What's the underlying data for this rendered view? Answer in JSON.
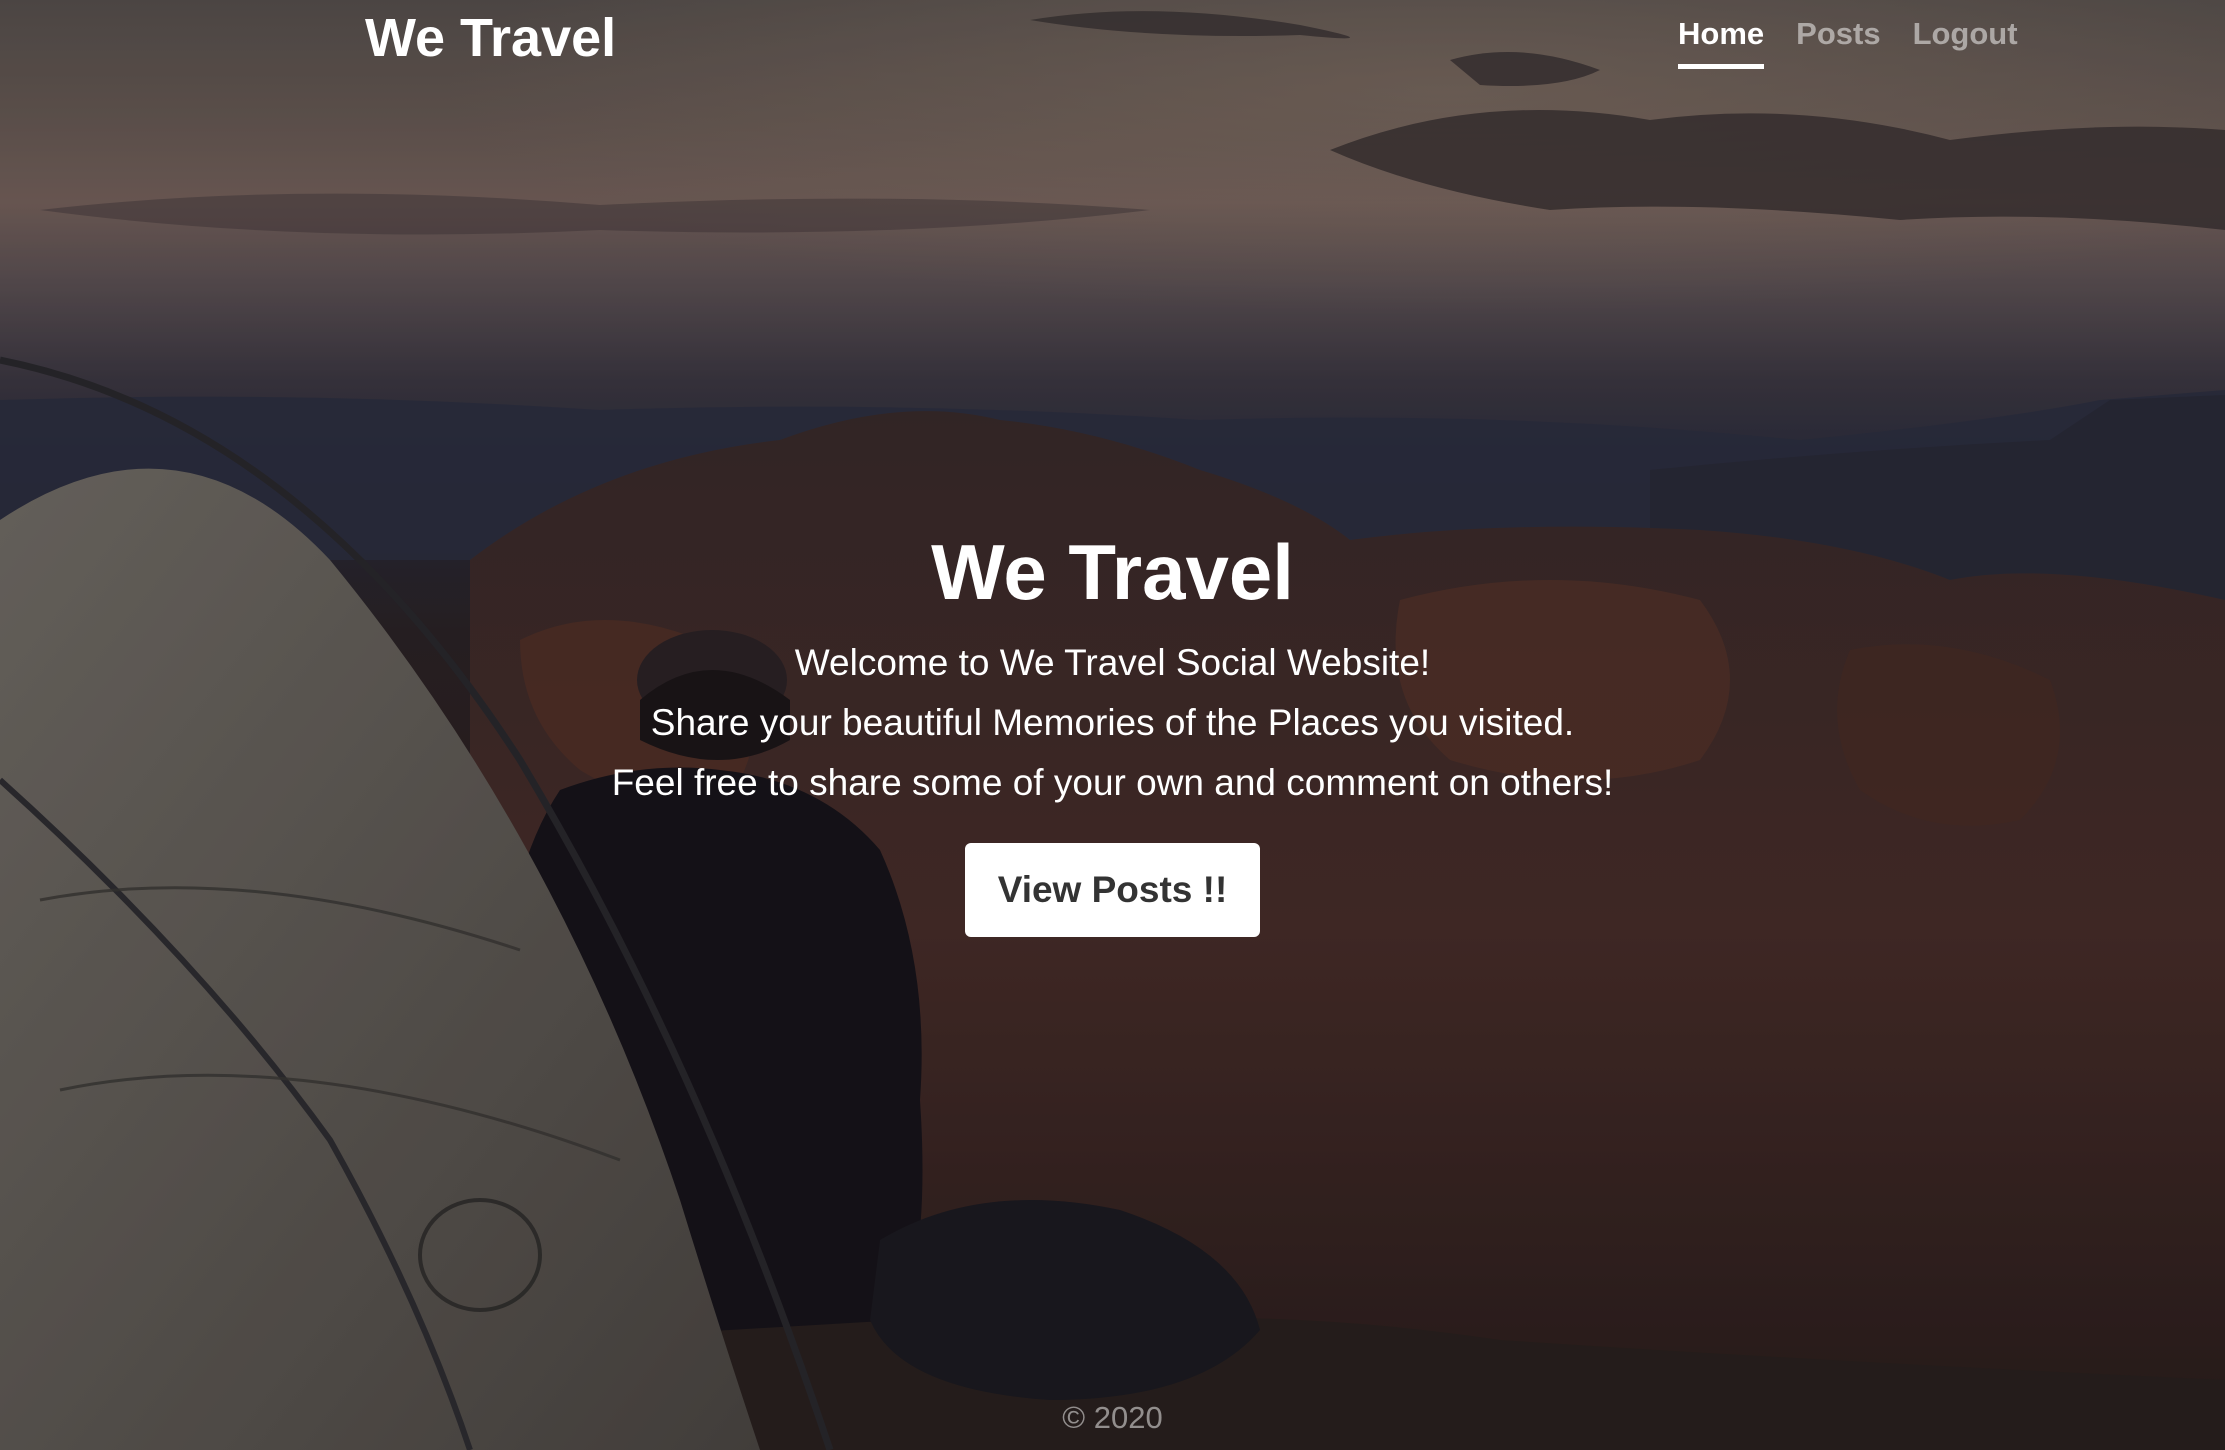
{
  "navbar": {
    "brand": "We Travel",
    "links": [
      {
        "label": "Home",
        "active": true
      },
      {
        "label": "Posts",
        "active": false
      },
      {
        "label": "Logout",
        "active": false
      }
    ]
  },
  "hero": {
    "title": "We Travel",
    "lines": [
      "Welcome to We Travel Social Website!",
      "Share your beautiful Memories of the Places you visited.",
      "Feel free to share some of your own and comment on others!"
    ],
    "button_label": "View Posts !!"
  },
  "footer": {
    "text": "© 2020"
  },
  "colors": {
    "text": "#ffffff",
    "muted_text": "rgba(255,255,255,0.5)",
    "button_bg": "#ffffff",
    "button_text": "#333333"
  }
}
